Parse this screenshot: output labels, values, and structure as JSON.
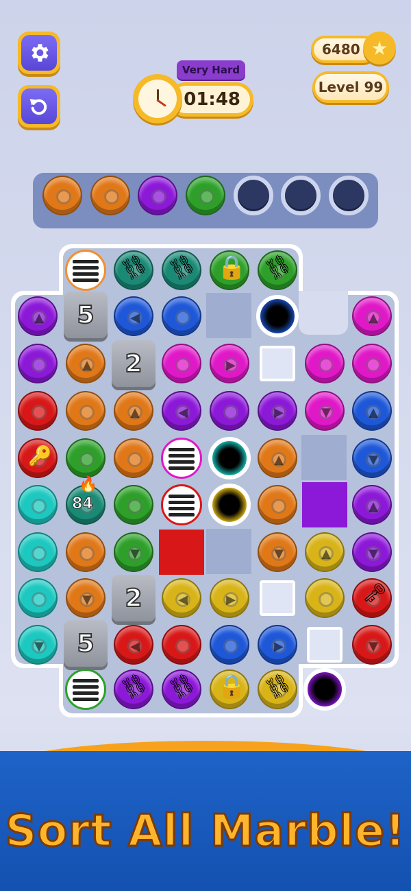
{
  "header": {
    "difficulty": "Very Hard",
    "timer": "01:48",
    "coins": "6480",
    "level": "Level 99"
  },
  "colors": {
    "orange": "#e07818",
    "purple": "#8c18d8",
    "green": "#2ea02a",
    "blue": "#1e58d8",
    "magenta": "#e018c8",
    "red": "#d81818",
    "cyan": "#1cc8c0",
    "yellow": "#d8b418",
    "teal": "#1a8a76"
  },
  "tray": [
    "orange",
    "orange",
    "purple",
    "green",
    "empty",
    "empty",
    "empty"
  ],
  "board": {
    "stones": [
      "5",
      "2",
      "2",
      "5"
    ],
    "counter": "84"
  },
  "banner": {
    "text": "Sort All Marble!"
  }
}
